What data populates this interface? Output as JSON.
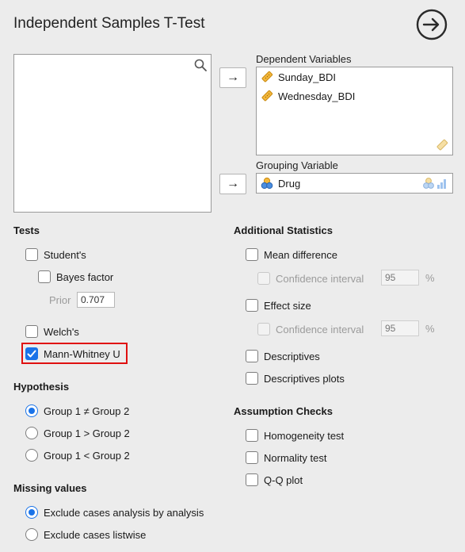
{
  "header": {
    "title": "Independent Samples T-Test"
  },
  "variables": {
    "dependent_label": "Dependent Variables",
    "dependent": [
      "Sunday_BDI",
      "Wednesday_BDI"
    ],
    "grouping_label": "Grouping Variable",
    "grouping": "Drug"
  },
  "tests": {
    "heading": "Tests",
    "students": {
      "label": "Student's",
      "checked": false
    },
    "bayes": {
      "label": "Bayes factor",
      "checked": false
    },
    "prior_label": "Prior",
    "prior_value": "0.707",
    "welch": {
      "label": "Welch's",
      "checked": false
    },
    "mann_whitney": {
      "label": "Mann-Whitney U",
      "checked": true
    }
  },
  "hypothesis": {
    "heading": "Hypothesis",
    "options": [
      "Group 1 ≠ Group 2",
      "Group 1 > Group 2",
      "Group 1 < Group 2"
    ],
    "selected": 0
  },
  "missing": {
    "heading": "Missing values",
    "options": [
      "Exclude cases analysis by analysis",
      "Exclude cases listwise"
    ],
    "selected": 0
  },
  "additional": {
    "heading": "Additional Statistics",
    "mean_difference": "Mean difference",
    "ci_label": "Confidence interval",
    "ci1_value": "95",
    "effect_size": "Effect size",
    "ci2_value": "95",
    "percent": "%",
    "descriptives": "Descriptives",
    "descriptives_plots": "Descriptives plots"
  },
  "assumptions": {
    "heading": "Assumption Checks",
    "homogeneity": "Homogeneity test",
    "normality": "Normality test",
    "qq": "Q-Q plot"
  },
  "colors": {
    "accent": "#1a73e8",
    "highlight": "#e01010",
    "panel": "#ececec"
  }
}
